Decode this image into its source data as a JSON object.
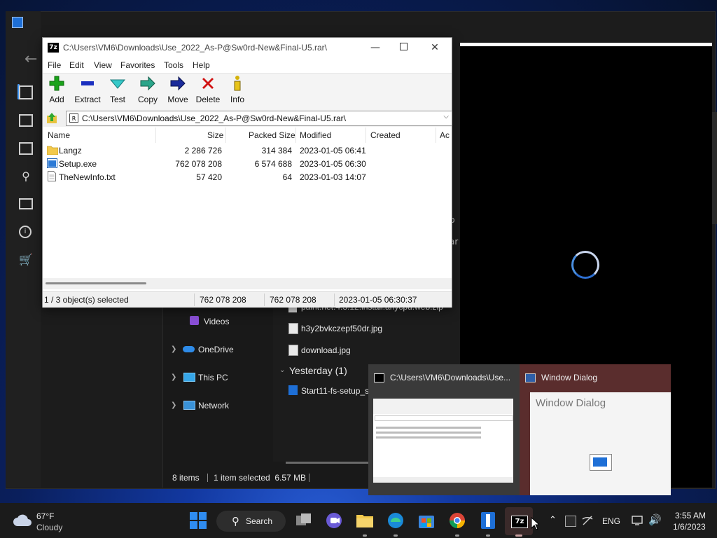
{
  "colors": {
    "accent": "#0a64d6",
    "taskbar": "#1b1b1b",
    "delete_red": "#d11414",
    "add_green": "#19a319"
  },
  "sevenzip": {
    "logo": "7z",
    "title": "C:\\Users\\VM6\\Downloads\\Use_2022_As-P@Sw0rd-New&Final-U5.rar\\",
    "menu": [
      "File",
      "Edit",
      "View",
      "Favorites",
      "Tools",
      "Help"
    ],
    "toolbar": [
      {
        "label": "Add",
        "icon": "plus-icon"
      },
      {
        "label": "Extract",
        "icon": "minus-icon"
      },
      {
        "label": "Test",
        "icon": "check-icon"
      },
      {
        "label": "Copy",
        "icon": "arrow-right-icon"
      },
      {
        "label": "Move",
        "icon": "arrow-right-icon"
      },
      {
        "label": "Delete",
        "icon": "x-icon"
      },
      {
        "label": "Info",
        "icon": "info-icon"
      }
    ],
    "address": "C:\\Users\\VM6\\Downloads\\Use_2022_As-P@Sw0rd-New&Final-U5.rar\\",
    "columns": [
      "Name",
      "Size",
      "Packed Size",
      "Modified",
      "Created",
      "Ac"
    ],
    "rows": [
      {
        "name": "Langz",
        "type": "folder",
        "size": "2 286 726",
        "packed": "314 384",
        "modified": "2023-01-05 06:41"
      },
      {
        "name": "Setup.exe",
        "type": "exe",
        "size": "762 078 208",
        "packed": "6 574 688",
        "modified": "2023-01-05 06:30"
      },
      {
        "name": "TheNewInfo.txt",
        "type": "txt",
        "size": "57 420",
        "packed": "64",
        "modified": "2023-01-03 14:07"
      }
    ],
    "status": {
      "selected": "1 / 3 object(s) selected",
      "size": "762 078 208",
      "packed": "762 078 208",
      "modified": "2023-01-05 06:30:37"
    }
  },
  "explorer": {
    "nav": [
      {
        "label": "Videos",
        "icon": "videos-icon"
      },
      {
        "label": "OneDrive",
        "icon": "cloud-icon"
      },
      {
        "label": "This PC",
        "icon": "monitor-icon"
      },
      {
        "label": "Network",
        "icon": "network-icon"
      }
    ],
    "files": [
      {
        "name": "paint.net.4.3.12.install.anycpu.web.zip"
      },
      {
        "name": "h3y2bvkczepf50dr.jpg"
      },
      {
        "name": "download.jpg"
      }
    ],
    "group": "Yesterday (1)",
    "group_file": "Start11-fs-setup_s",
    "status": {
      "items": "8 items",
      "selected": "1 item selected  6.57 MB"
    },
    "side_fragments": [
      "p",
      "ar"
    ]
  },
  "thumbnails": [
    {
      "title": "C:\\Users\\VM6\\Downloads\\Use..."
    },
    {
      "title": "Window Dialog",
      "preview_title": "Window Dialog"
    }
  ],
  "taskbar": {
    "weather_temp": "67°F",
    "weather_desc": "Cloudy",
    "search": "Search",
    "active_app": "7z",
    "lang": "ENG",
    "time": "3:55 AM",
    "date": "1/6/2023"
  }
}
